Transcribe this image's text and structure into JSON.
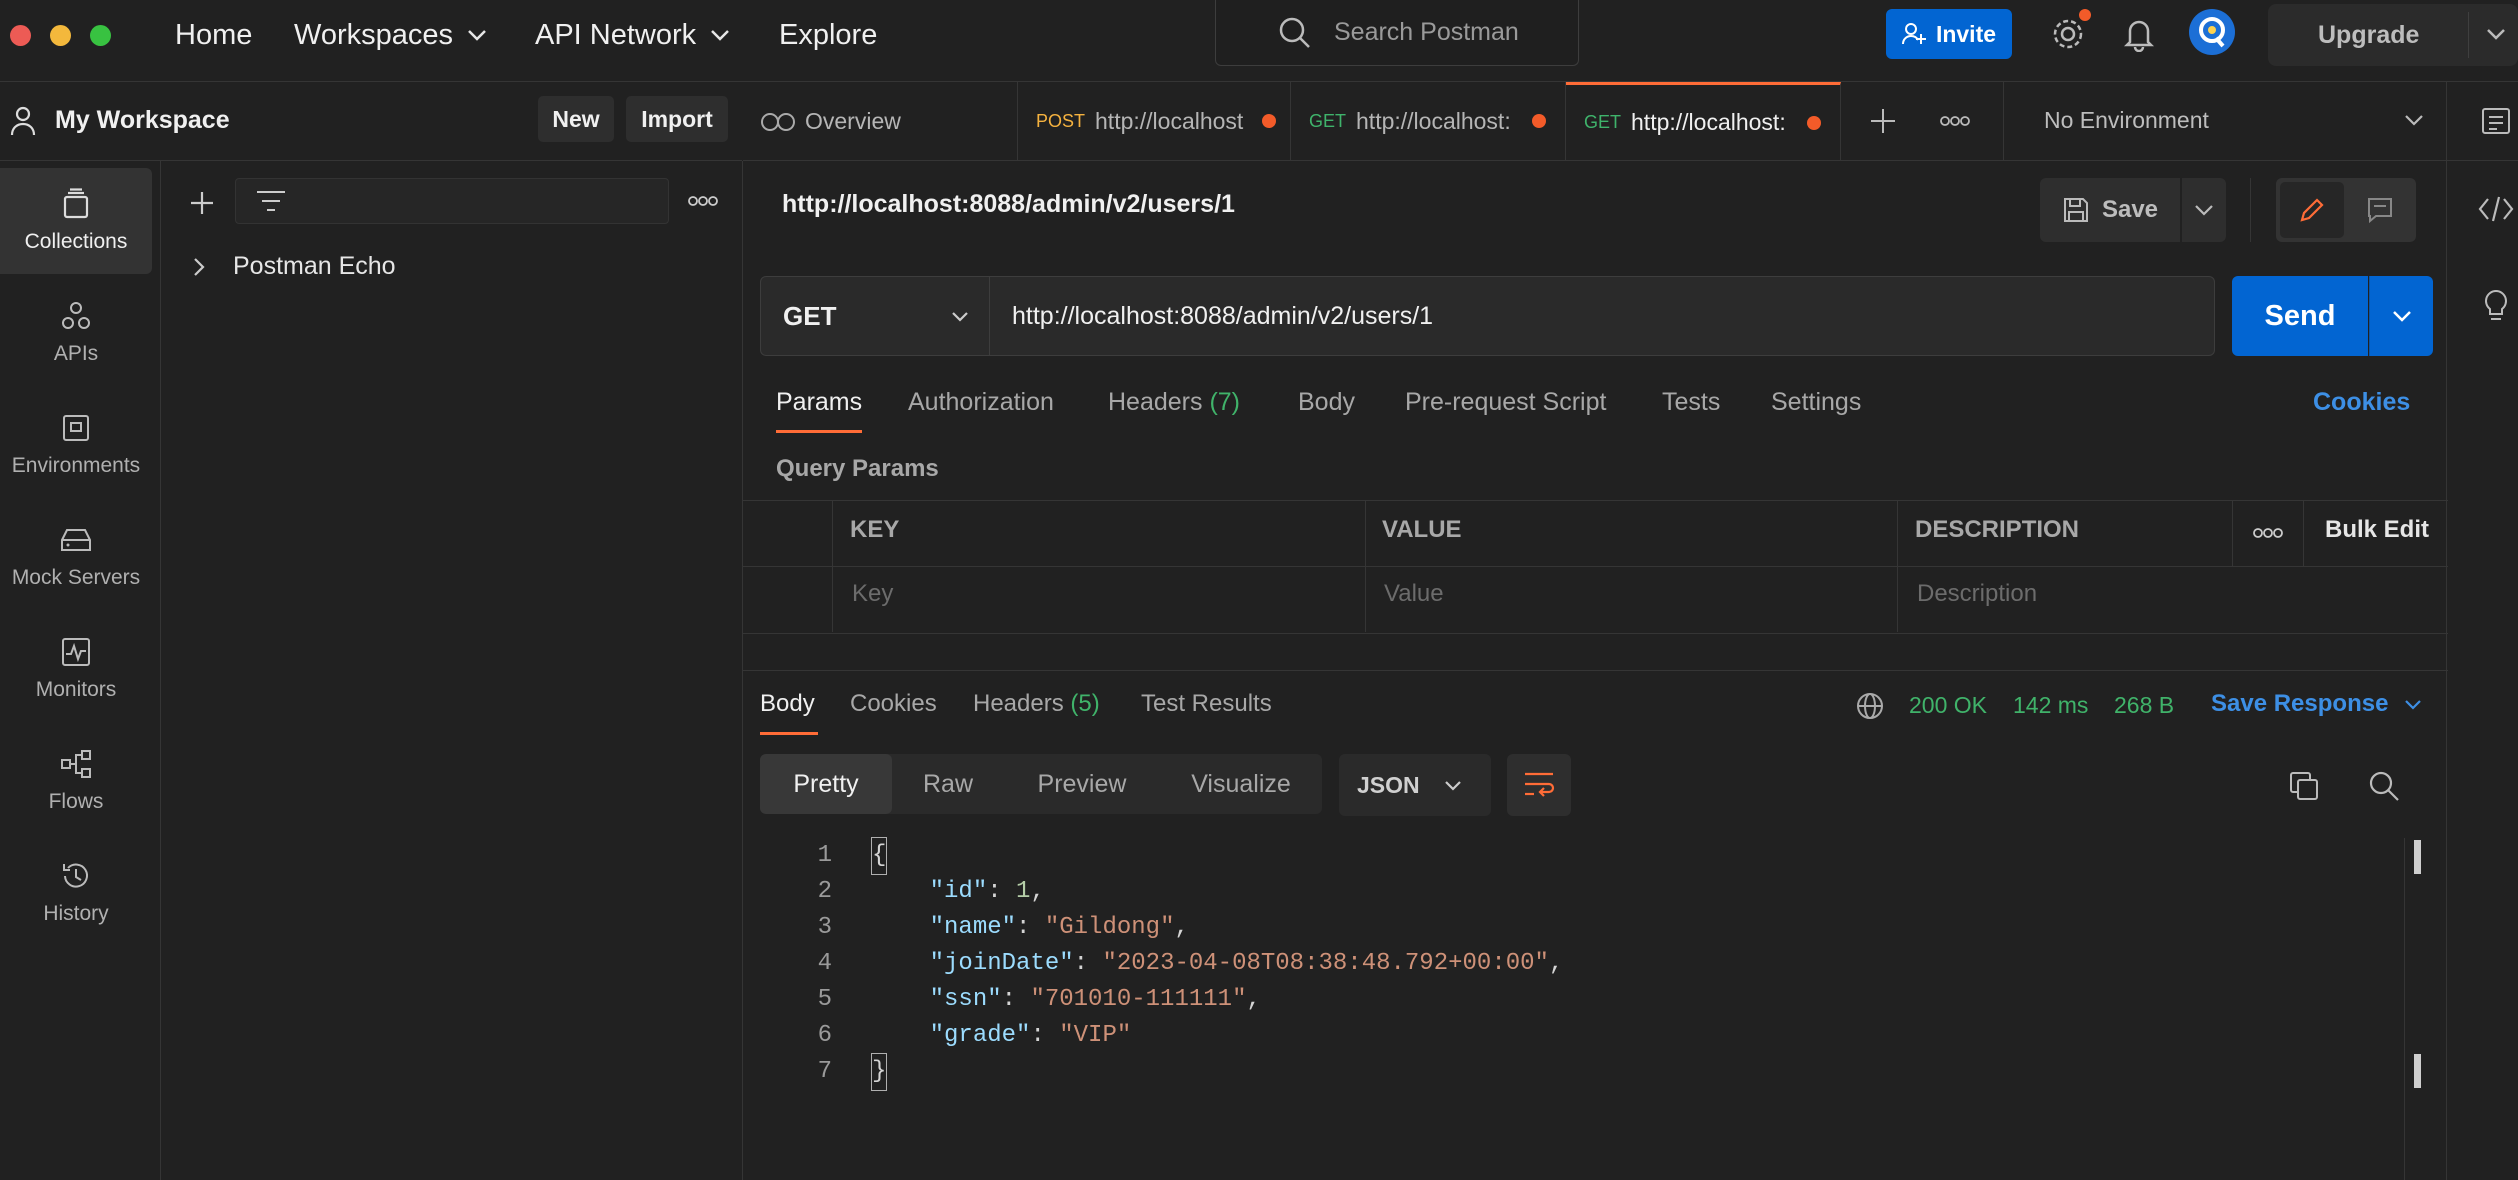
{
  "topbar": {
    "nav": [
      "Home",
      "Workspaces",
      "API Network",
      "Explore"
    ],
    "search_placeholder": "Search Postman",
    "invite_label": "Invite",
    "upgrade_label": "Upgrade"
  },
  "workspace": {
    "title": "My Workspace",
    "new_label": "New",
    "import_label": "Import"
  },
  "rail": [
    {
      "label": "Collections",
      "icon": "collections-icon"
    },
    {
      "label": "APIs",
      "icon": "apis-icon"
    },
    {
      "label": "Environments",
      "icon": "environments-icon"
    },
    {
      "label": "Mock Servers",
      "icon": "mock-servers-icon"
    },
    {
      "label": "Monitors",
      "icon": "monitors-icon"
    },
    {
      "label": "Flows",
      "icon": "flows-icon"
    },
    {
      "label": "History",
      "icon": "history-icon"
    }
  ],
  "collections": [
    {
      "name": "Postman Echo"
    }
  ],
  "tabs": [
    {
      "method": "",
      "label": "Overview"
    },
    {
      "method": "POST",
      "label": "http://localhost"
    },
    {
      "method": "GET",
      "label": "http://localhost:"
    },
    {
      "method": "GET",
      "label": "http://localhost:"
    }
  ],
  "environment": "No Environment",
  "request": {
    "title": "http://localhost:8088/admin/v2/users/1",
    "save_label": "Save",
    "method": "GET",
    "url": "http://localhost:8088/admin/v2/users/1",
    "send_label": "Send",
    "tabs": [
      "Params",
      "Authorization",
      "Headers",
      "Body",
      "Pre-request Script",
      "Tests",
      "Settings"
    ],
    "headers_count": "(7)",
    "cookies_label": "Cookies",
    "query_params_title": "Query Params",
    "columns": [
      "KEY",
      "VALUE",
      "DESCRIPTION"
    ],
    "bulk_edit_label": "Bulk Edit",
    "placeholders": {
      "key": "Key",
      "value": "Value",
      "description": "Description"
    }
  },
  "response": {
    "tabs": [
      "Body",
      "Cookies",
      "Headers",
      "Test Results"
    ],
    "headers_count": "(5)",
    "status": "200 OK",
    "time": "142 ms",
    "size": "268 B",
    "save_response_label": "Save Response",
    "views": [
      "Pretty",
      "Raw",
      "Preview",
      "Visualize"
    ],
    "format": "JSON",
    "line_numbers": [
      "1",
      "2",
      "3",
      "4",
      "5",
      "6",
      "7"
    ],
    "body": {
      "open": "{",
      "close": "}",
      "fields": [
        {
          "key": "\"id\"",
          "value": "1",
          "comma": ","
        },
        {
          "key": "\"name\"",
          "value": "\"Gildong\"",
          "comma": ","
        },
        {
          "key": "\"joinDate\"",
          "value": "\"2023-04-08T08:38:48.792+00:00\"",
          "comma": ","
        },
        {
          "key": "\"ssn\"",
          "value": "\"701010-111111\"",
          "comma": ","
        },
        {
          "key": "\"grade\"",
          "value": "\"VIP\"",
          "comma": ""
        }
      ]
    }
  },
  "colors": {
    "accent": "#ff6c37",
    "primary_button": "#0265d2",
    "status_green": "#40b36a",
    "link_blue": "#3d8fe5"
  }
}
